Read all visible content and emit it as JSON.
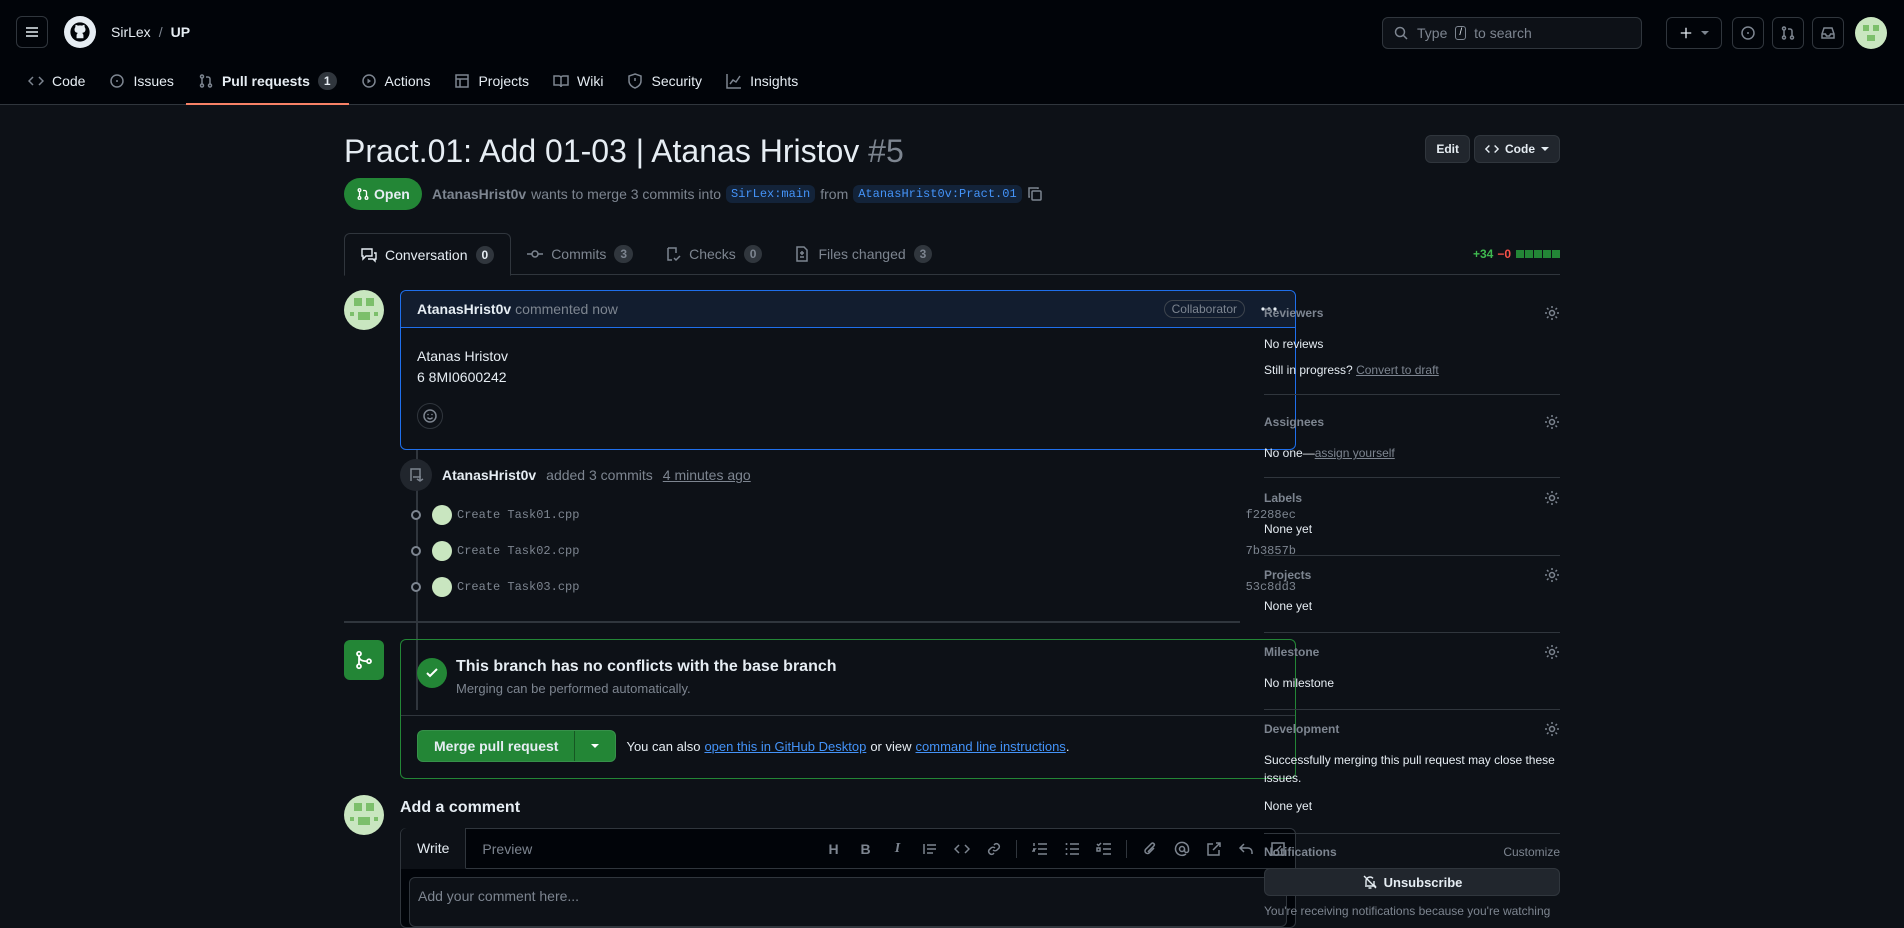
{
  "header": {
    "owner": "SirLex",
    "separator": "/",
    "repo": "UP",
    "search_before": "Type",
    "search_key": "/",
    "search_after": "to search"
  },
  "repo_nav": [
    {
      "label": "Code",
      "icon": "code-icon"
    },
    {
      "label": "Issues",
      "icon": "issue-icon"
    },
    {
      "label": "Pull requests",
      "icon": "pull-request-icon",
      "count": "1",
      "selected": true
    },
    {
      "label": "Actions",
      "icon": "play-icon"
    },
    {
      "label": "Projects",
      "icon": "table-icon"
    },
    {
      "label": "Wiki",
      "icon": "book-icon"
    },
    {
      "label": "Security",
      "icon": "shield-icon"
    },
    {
      "label": "Insights",
      "icon": "graph-icon"
    }
  ],
  "pr": {
    "title": "Pract.01: Add 01-03 | Atanas Hristov",
    "number": "#5",
    "edit_label": "Edit",
    "code_label": "Code",
    "state": "Open",
    "author": "AtanasHrist0v",
    "merge_text": "wants to merge 3 commits into",
    "base_branch": "SirLex:main",
    "from_text": "from",
    "head_branch": "AtanasHrist0v:Pract.01"
  },
  "tabs": [
    {
      "label": "Conversation",
      "count": "0",
      "selected": true
    },
    {
      "label": "Commits",
      "count": "3"
    },
    {
      "label": "Checks",
      "count": "0"
    },
    {
      "label": "Files changed",
      "count": "3"
    }
  ],
  "diffstat": {
    "additions": "+34",
    "deletions": "−0"
  },
  "comment": {
    "author": "AtanasHrist0v",
    "time": "commented now",
    "badge": "Collaborator",
    "line1": "Atanas Hristov",
    "line2": "6 8MI0600242"
  },
  "event": {
    "author": "AtanasHrist0v",
    "text": "added 3 commits",
    "time": "4 minutes ago"
  },
  "commits": [
    {
      "message": "Create Task01.cpp",
      "sha": "f2288ec"
    },
    {
      "message": "Create Task02.cpp",
      "sha": "7b3857b"
    },
    {
      "message": "Create Task03.cpp",
      "sha": "53c8dd3"
    }
  ],
  "merge": {
    "title": "This branch has no conflicts with the base branch",
    "subtitle": "Merging can be performed automatically.",
    "button": "Merge pull request",
    "also_text": "You can also",
    "desktop_link": "open this in GitHub Desktop",
    "or_view": "or view",
    "cli_link": "command line instructions",
    "period": "."
  },
  "add_comment": {
    "heading": "Add a comment",
    "write_tab": "Write",
    "preview_tab": "Preview",
    "placeholder": "Add your comment here..."
  },
  "sidebar": {
    "reviewers": {
      "label": "Reviewers",
      "value": "No reviews",
      "progress": "Still in progress?",
      "draft_link": "Convert to draft"
    },
    "assignees": {
      "label": "Assignees",
      "value": "No one—",
      "assign_link": "assign yourself"
    },
    "labels": {
      "label": "Labels",
      "value": "None yet"
    },
    "projects": {
      "label": "Projects",
      "value": "None yet"
    },
    "milestone": {
      "label": "Milestone",
      "value": "No milestone"
    },
    "development": {
      "label": "Development",
      "desc": "Successfully merging this pull request may close these issues.",
      "value": "None yet"
    },
    "notifications": {
      "label": "Notifications",
      "customize": "Customize",
      "button": "Unsubscribe",
      "note": "You're receiving notifications because you're watching"
    }
  },
  "colors": {
    "accent_green": "#238636",
    "link_blue": "#4493f8",
    "tab_underline": "#f78166"
  }
}
